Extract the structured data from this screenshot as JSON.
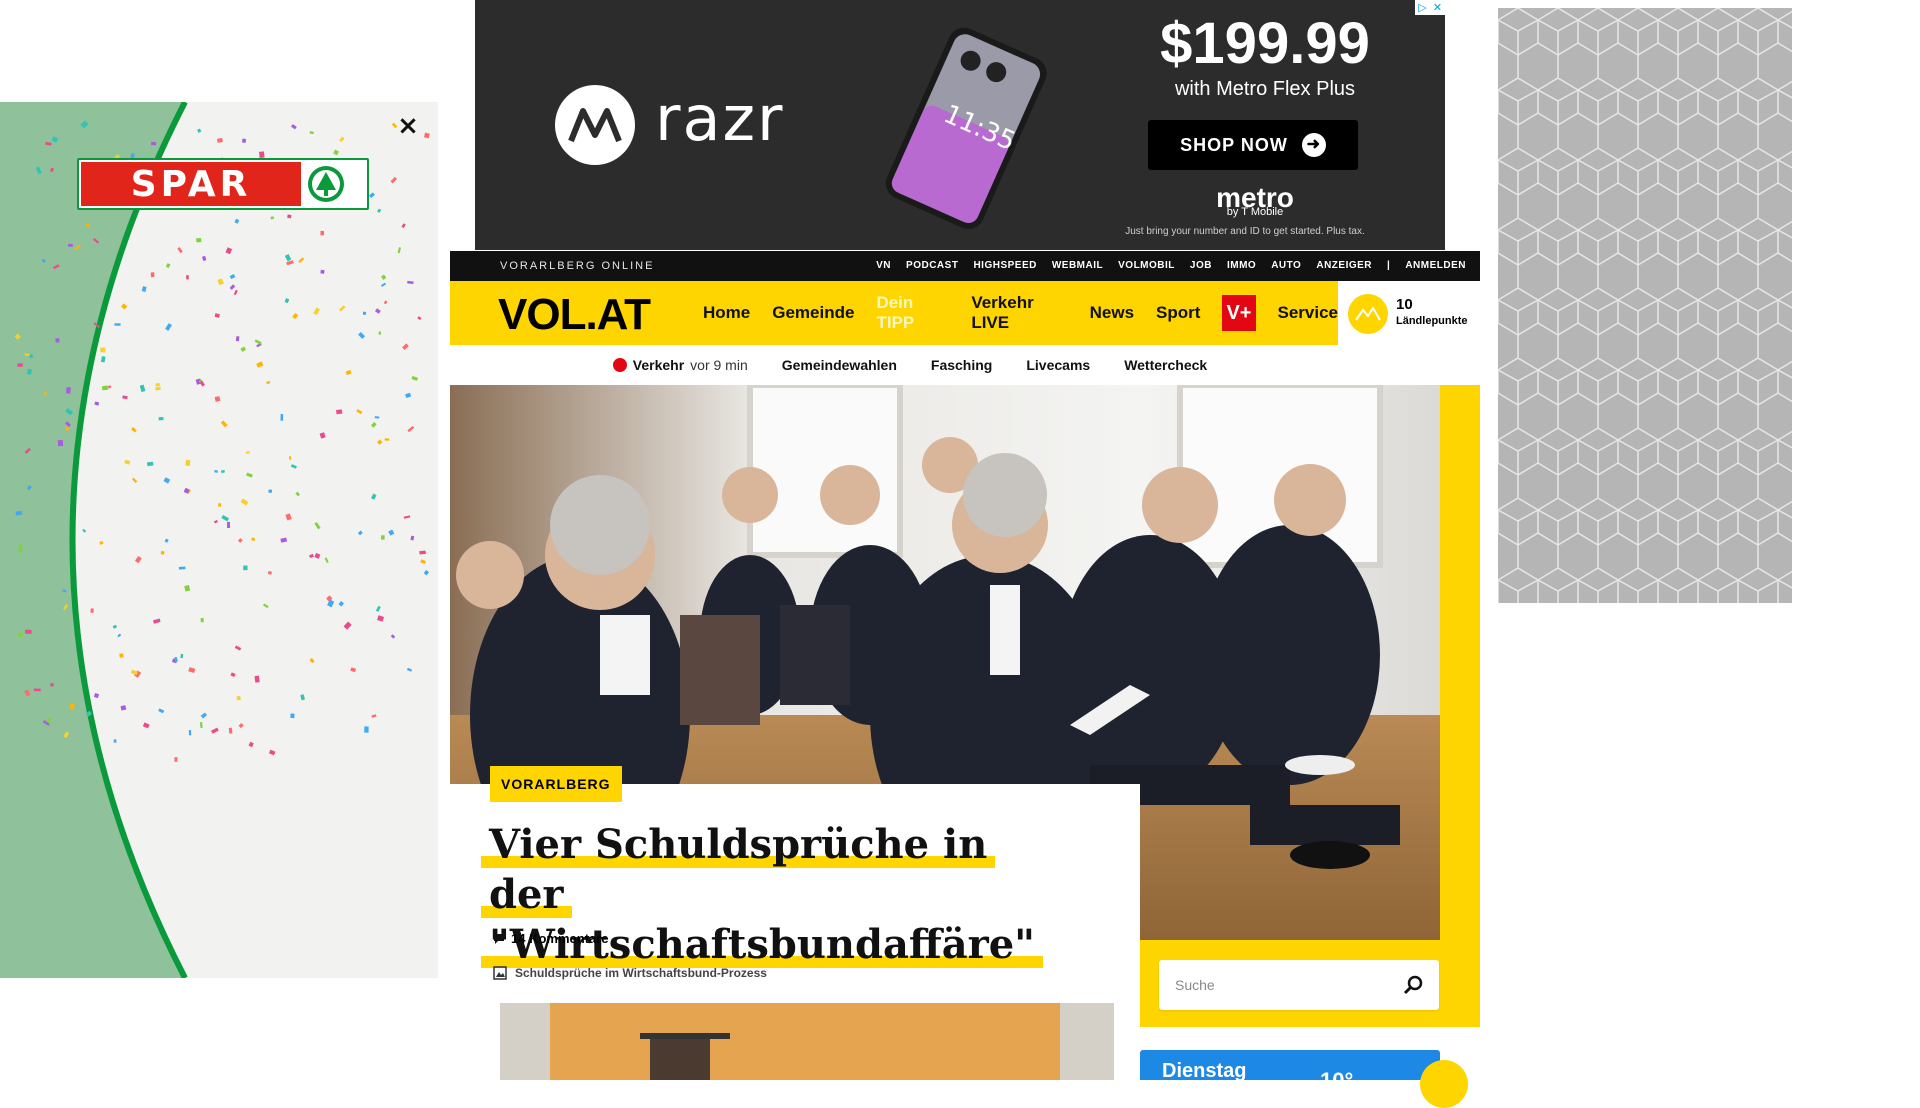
{
  "left_ad": {
    "brand": "SPAR",
    "close_label": "×",
    "colors": {
      "green": "#0a9a3c",
      "panel_green": "#8fc19a",
      "red": "#e1251b"
    }
  },
  "top_ad": {
    "product": "razr",
    "price": "$199.99",
    "subtitle": "with Metro Flex Plus",
    "cta": "SHOP NOW",
    "carrier": "metro",
    "carrier_sub": "by T Mobile",
    "fine_print": "Just bring your number and ID to get started. Plus tax.",
    "phone_time": "11:35"
  },
  "topbar": {
    "brand": "VORARLBERG ONLINE",
    "links": [
      "VN",
      "PODCAST",
      "HIGHSPEED",
      "WEBMAIL",
      "VOLMOBIL",
      "JOB",
      "IMMO",
      "AUTO",
      "ANZEIGER",
      "|",
      "ANMELDEN"
    ]
  },
  "nav": {
    "logo": "VOL.AT",
    "items": [
      "Home",
      "Gemeinde",
      "Dein TIPP",
      "Verkehr LIVE",
      "News",
      "Sport"
    ],
    "vplus": "V+",
    "service": "Service",
    "points_value": "10",
    "points_label": "Ländlepunkte"
  },
  "subnav": {
    "live_label": "Verkehr",
    "live_time": "vor 9 min",
    "items": [
      "Gemeindewahlen",
      "Fasching",
      "Livecams",
      "Wettercheck"
    ]
  },
  "article": {
    "category": "VORARLBERG",
    "headline_line1": "Vier Schuldsprüche in der",
    "headline_line2": "\"Wirtschaftsbundaffäre\"",
    "comments": "14 Kommentare",
    "gallery": "Schuldsprüche im Wirtschaftsbund-Prozess"
  },
  "search": {
    "placeholder": "Suche"
  },
  "weather": {
    "day": "Dienstag",
    "temp": "10°"
  },
  "colors": {
    "yellow": "#ffd500",
    "black": "#111111",
    "red": "#e30613",
    "blue": "#1e88e5"
  }
}
